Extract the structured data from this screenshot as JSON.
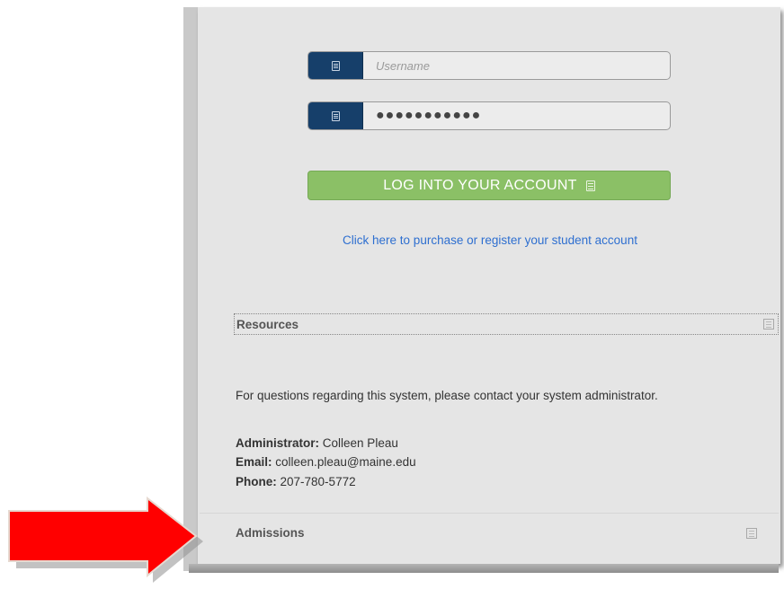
{
  "login": {
    "username_placeholder": "Username",
    "password_masked": "●●●●●●●●●●●",
    "submit_label": "LOG INTO YOUR ACCOUNT",
    "register_link": "Click here to purchase or register your student account"
  },
  "resources": {
    "title": "Resources",
    "contact_text": "For questions regarding this system, please contact your system administrator.",
    "administrator_label": "Administrator:",
    "administrator_value": "Colleen Pleau",
    "email_label": "Email:",
    "email_value": "colleen.pleau@maine.edu",
    "phone_label": "Phone:",
    "phone_value": "207-780-5772"
  },
  "admissions": {
    "title": "Admissions"
  },
  "colors": {
    "addon": "#163f6a",
    "button": "#8bc066",
    "link": "#2e6fd0",
    "arrow": "#ff0000"
  }
}
